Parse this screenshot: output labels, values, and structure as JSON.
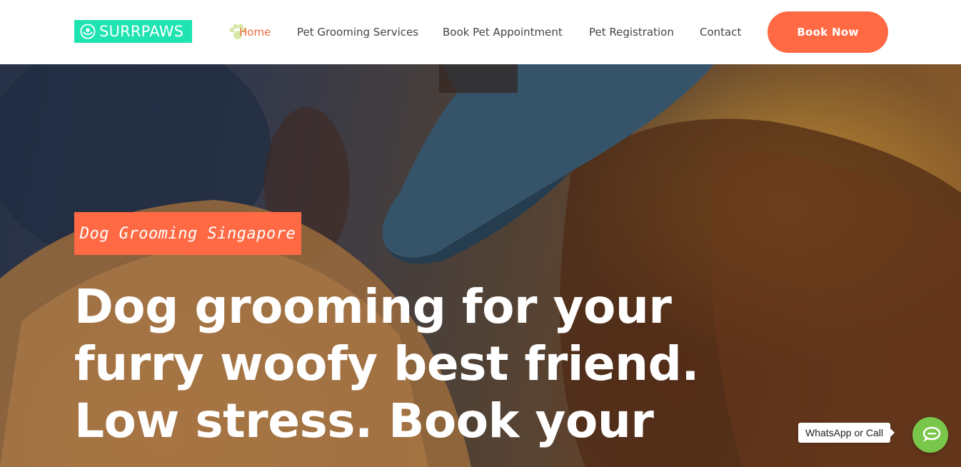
{
  "brand": {
    "logo_text": "SURRPAWS",
    "logo_bg": "#1fe3b1"
  },
  "nav": {
    "items": [
      {
        "label": "Home",
        "active": true
      },
      {
        "label": "Pet Grooming Services",
        "active": false
      },
      {
        "label": "Book Pet Appointment",
        "active": false
      },
      {
        "label": "Pet Registration",
        "active": false
      },
      {
        "label": "Contact",
        "active": false
      }
    ],
    "active_color": "#f26a3e",
    "active_icon": "paw-icon"
  },
  "cta": {
    "book_label": "Book Now",
    "color": "#ff6a45"
  },
  "hero": {
    "tag": "Dog Grooming Singapore",
    "headline_lines": [
      "Dog grooming for your",
      "furry woofy best friend.",
      "Low stress. Book your"
    ]
  },
  "chat": {
    "label": "WhatsApp or Call",
    "icon": "chat-bubbles-icon",
    "color": "#79c74a"
  }
}
